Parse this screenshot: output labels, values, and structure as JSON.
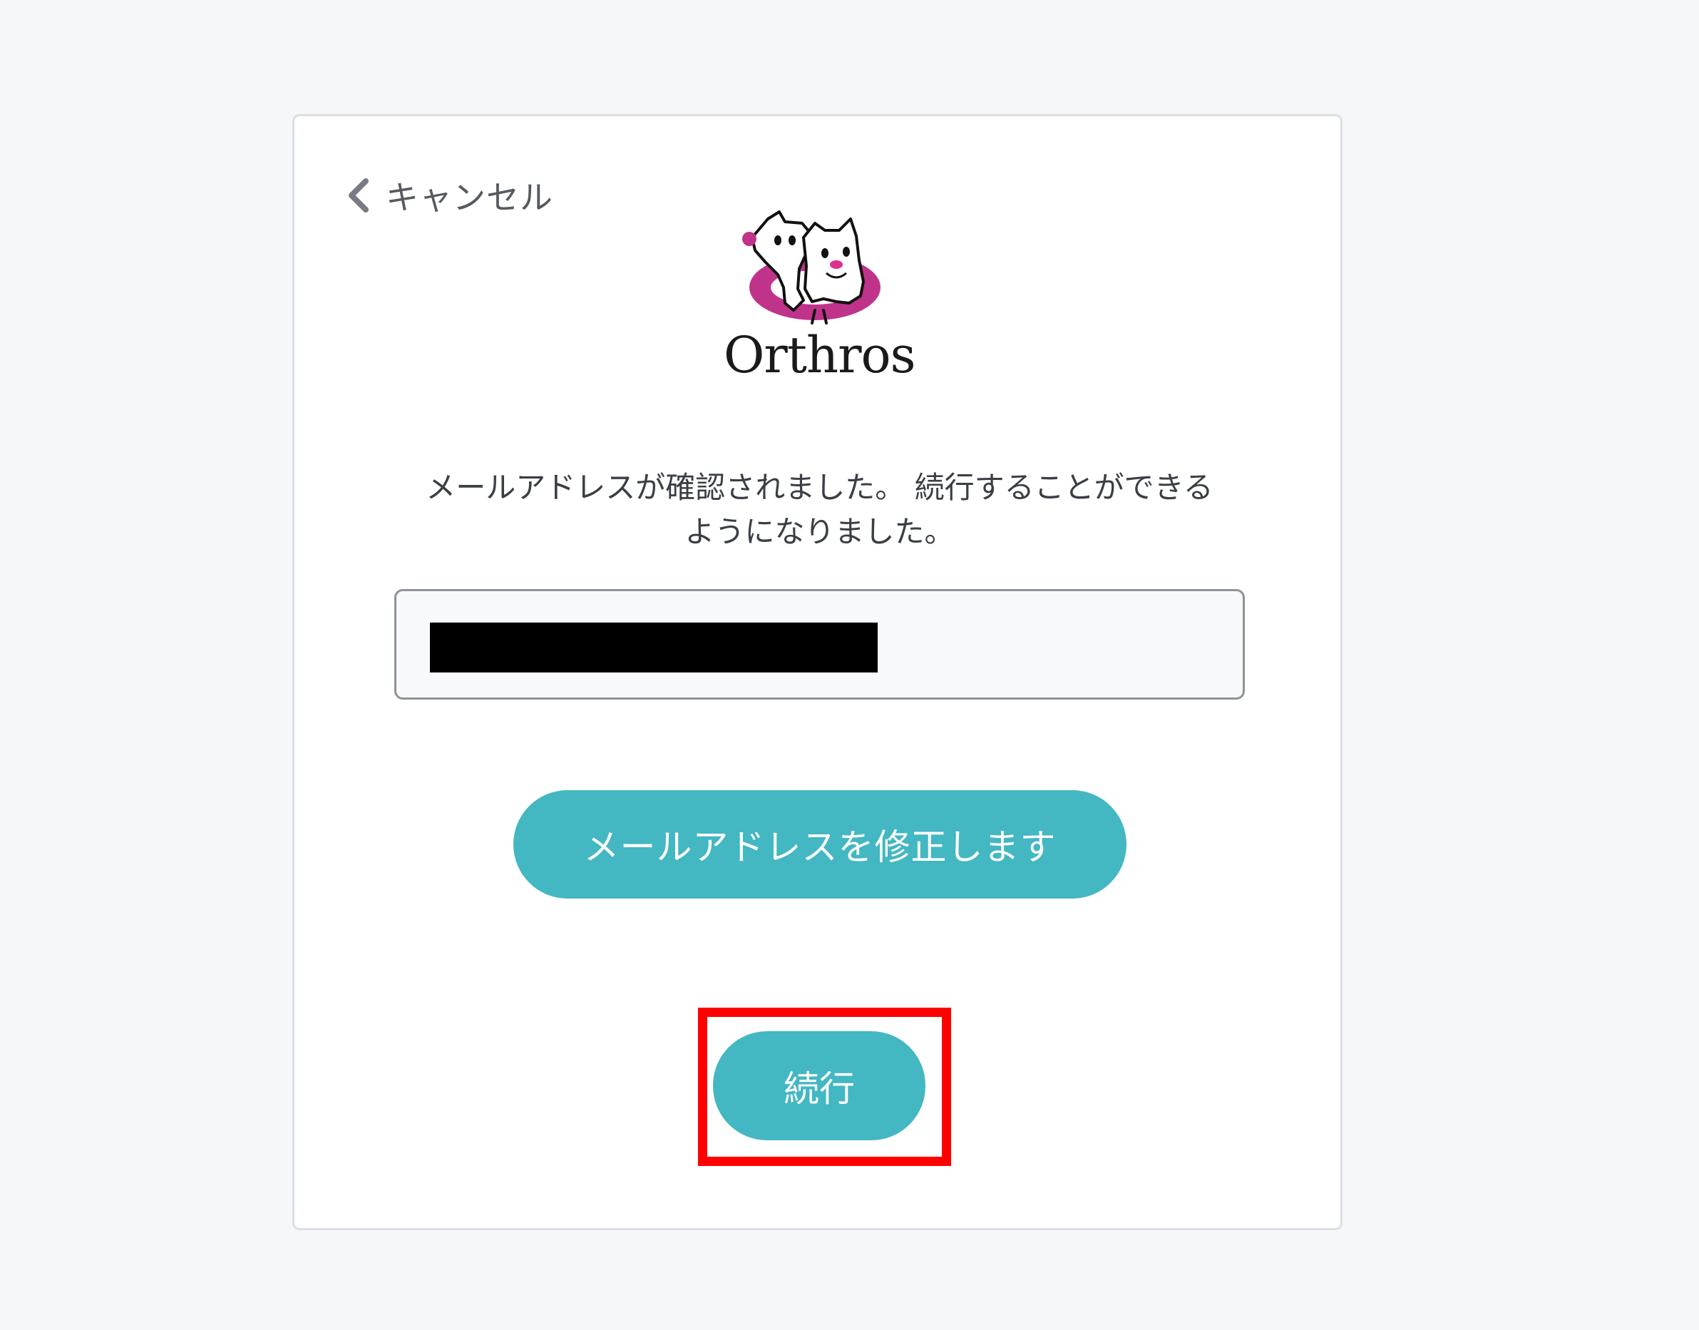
{
  "card": {
    "cancel_label": "キャンセル",
    "logo_text": "Orthros",
    "message_line1": "メールアドレスが確認されました。 続行することができる",
    "message_line2": "ようになりました。",
    "email_value": "",
    "fix_email_button": "メールアドレスを修正します",
    "continue_button": "続行"
  },
  "colors": {
    "page_background": "#f6f7f9",
    "button_teal": "#43b7c2",
    "highlight_red": "#ff0000",
    "logo_magenta": "#c0338a"
  },
  "icons": {
    "cancel": "chevron-left-icon",
    "logo": "orthros-dogs-logo"
  }
}
